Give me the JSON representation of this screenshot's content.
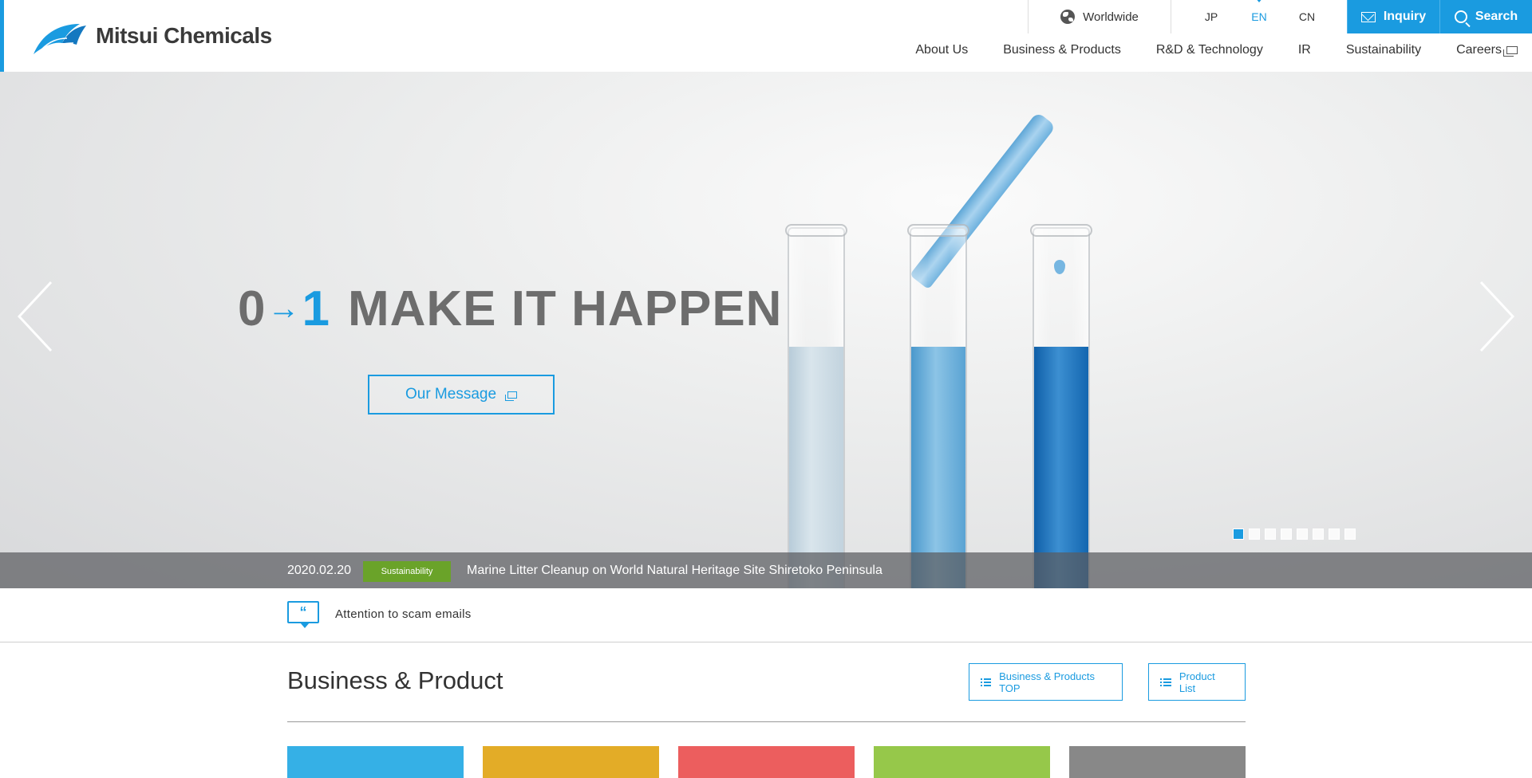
{
  "header": {
    "brand_name": "Mitsui Chemicals",
    "worldwide_label": "Worldwide",
    "languages": [
      {
        "label": "JP",
        "active": false
      },
      {
        "label": "EN",
        "active": true
      },
      {
        "label": "CN",
        "active": false
      }
    ],
    "inquiry_label": "Inquiry",
    "search_label": "Search",
    "nav": [
      {
        "label": "About Us"
      },
      {
        "label": "Business & Products"
      },
      {
        "label": "R&D & Technology"
      },
      {
        "label": "IR"
      },
      {
        "label": "Sustainability"
      },
      {
        "label": "Careers",
        "external": true
      }
    ]
  },
  "hero": {
    "headline_from": "0",
    "headline_arrow": "→",
    "headline_to": "1",
    "headline_text": "MAKE IT HAPPEN",
    "cta_label": "Our Message",
    "slide_count": 8,
    "active_slide": 1
  },
  "news": {
    "date": "2020.02.20",
    "tag": "Sustainability",
    "title": "Marine Litter Cleanup on World Natural Heritage Site Shiretoko Peninsula"
  },
  "notice": {
    "text": "Attention to scam emails",
    "icon": "quote-icon"
  },
  "business_section": {
    "title": "Business & Product",
    "top_button": "Business & Products TOP",
    "list_button": "Product List",
    "card_colors": [
      "#35b0e6",
      "#e3ac27",
      "#ec5e5e",
      "#96c84a",
      "#888888"
    ]
  },
  "colors": {
    "accent": "#1a9be0",
    "tag_green": "#6aa329"
  }
}
